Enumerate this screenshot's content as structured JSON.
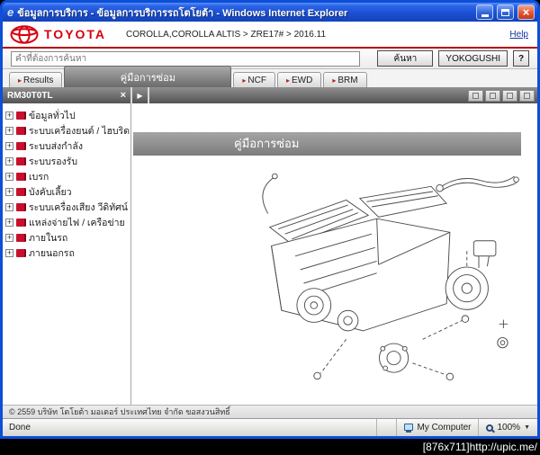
{
  "window": {
    "title": "ข้อมูลการบริการ - ข้อมูลการบริการรถโตโยต้า - Windows Internet Explorer",
    "close_glyph": "×"
  },
  "header": {
    "brand": "TOYOTA",
    "breadcrumb": "COROLLA,COROLLA ALTIS > ZRE17# > 2016.11",
    "help_link": "Help"
  },
  "search": {
    "placeholder": "คำที่ต้องการค้นหา",
    "search_button": "ค้นหา",
    "yokogushi_button": "YOKOGUSHI",
    "help_button": "?"
  },
  "tabs": [
    "Results",
    "คู่มือการซ่อม",
    "NCF",
    "EWD",
    "BRM"
  ],
  "panel": {
    "title": "RM30T0TL",
    "close": "×",
    "expand": "▶"
  },
  "sidebar": {
    "items": [
      "ข้อมูลทั่วไป",
      "ระบบเครื่องยนต์ / ไฮบริด",
      "ระบบส่งกำลัง",
      "ระบบรองรับ",
      "เบรก",
      "บังคับเลี้ยว",
      "ระบบเครื่องเสียง วีดิทัศน์ เท",
      "แหล่งจ่ายไฟ / เครือข่าย",
      "ภายในรถ",
      "ภายนอกรถ"
    ]
  },
  "content": {
    "banner": "คู่มือการซ่อม",
    "copyright": "© 2559 บริษัท โตโยต้า มอเตอร์ ประเทศไทย จำกัด ขอสงวนสิทธิ์"
  },
  "statusbar": {
    "status": "Done",
    "zone": "My Computer",
    "zoom": "100%",
    "zoom_caret": "▼"
  },
  "caption": "[876x711]http://upic.me/",
  "colors": {
    "toyota_red": "#EB0A1E",
    "titlebar_blue": "#1b4fd4",
    "active_tab_gray": "#6b6b6b",
    "header_rule_red": "#b40000"
  }
}
